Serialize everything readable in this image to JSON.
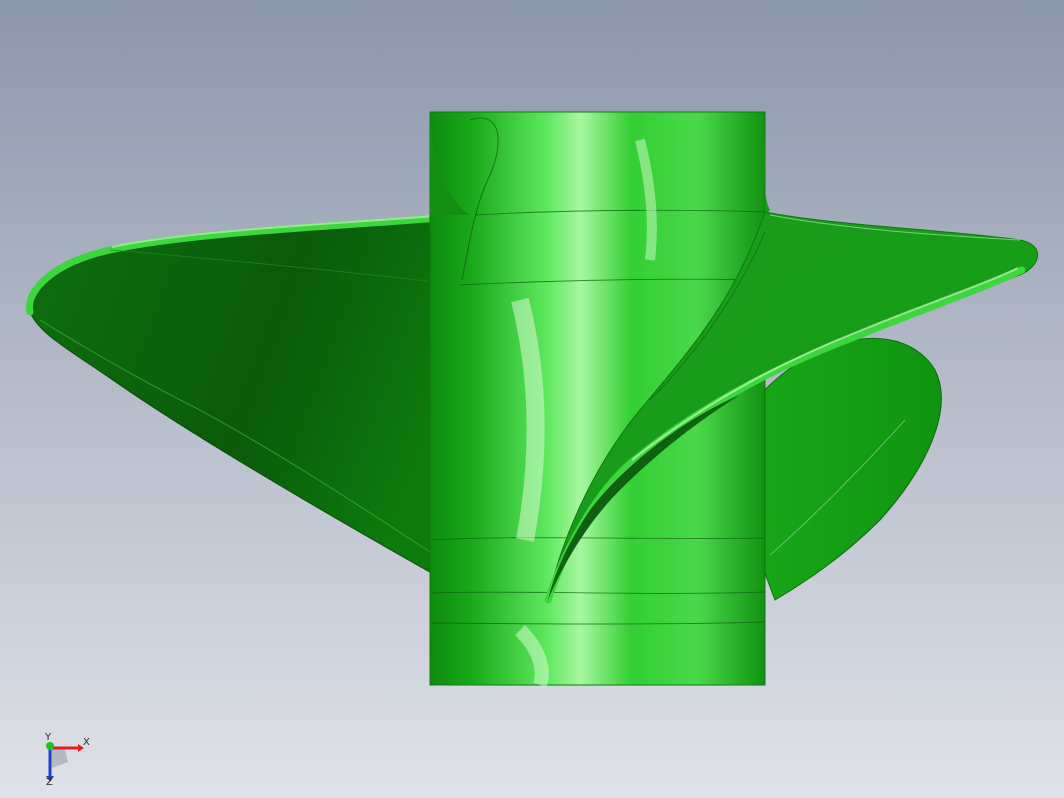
{
  "viewport": {
    "model": "propeller",
    "part_color": "#1fbf1f",
    "background_top": "#8d97ac",
    "background_bottom": "#dde1e8"
  },
  "triad": {
    "x_label": "X",
    "y_label": "Y",
    "z_label": "Z",
    "x_color": "#e02020",
    "y_color": "#22c022",
    "z_color": "#2040d0"
  }
}
